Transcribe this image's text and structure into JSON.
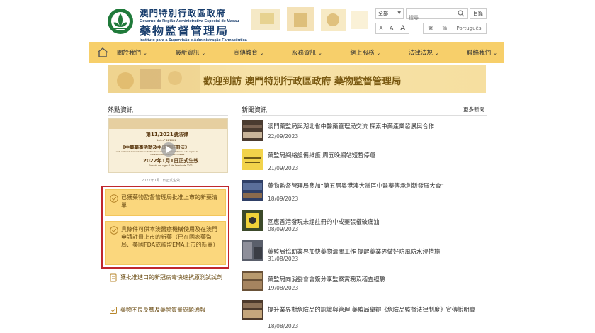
{
  "header": {
    "title_zh": "澳門特別行政區政府",
    "subtitle_pt_1": "Governo da Região Administrativa Especial de Macau",
    "title_zh_2": "藥物監督管理局",
    "subtitle_pt_2": "Instituto para a Supervisão e Administração Farmacêutica"
  },
  "search": {
    "scope_selected": "全部",
    "placeholder": "搜尋",
    "sitemap_label": "目錄"
  },
  "font_sizes": [
    "A",
    "A",
    "A"
  ],
  "languages": [
    "繁",
    "简",
    "Português"
  ],
  "nav": [
    {
      "label": "關於我們"
    },
    {
      "label": "最新資訊"
    },
    {
      "label": "宣傳教育"
    },
    {
      "label": "服務資訊"
    },
    {
      "label": "網上服務"
    },
    {
      "label": "法律法規"
    },
    {
      "label": "聯絡我們"
    }
  ],
  "welcome_text": "歡迎到訪 澳門特別行政區政府 藥物監督管理局",
  "hot": {
    "title": "熱點資訊",
    "poster": {
      "line1": "第11/2021號法律",
      "line2": "Lei n.º 11/2021",
      "line3": "《中藥藥事活動及中成藥註冊法》",
      "line4": "Lei da actividade farmacêutica no âmbito da medicina tradicional chinesa e do registo de",
      "line5": "medicamentos tradicionais chineses",
      "line6": "2022年1月1日正式生效",
      "line7": "Entrada em vigor: 1 de Janeiro de 2022",
      "caption": "2022年1月1日正式生效"
    },
    "items": [
      {
        "label": "已獲藥物監督管理局批准上市的新藥清單"
      },
      {
        "label": "具條件可供本澳醫療機構使用及在澳門申請註冊上市的新藥（已在國家藥監局、美國FDA或歐盟EMA上市的新藥）"
      },
      {
        "label": "獲批准進口的新冠病毒快速抗原測試試劑"
      },
      {
        "label": "藥物不良反應及藥物質量問題通報"
      }
    ]
  },
  "news": {
    "title": "新聞資訊",
    "more_label": "更多新聞",
    "items": [
      {
        "title": "澳門藥監局與湖北省中醫藥管理局交流 探索中藥產業發展與合作",
        "date": "22/09/2023"
      },
      {
        "title": "藥監局網絡設備維護 周五晚網站短暫停運",
        "date": "21/09/2023"
      },
      {
        "title": "藥物監督管理局參加“第五屆粵港澳大灣區中醫藥傳承創新發展大會”",
        "date": "18/09/2023"
      },
      {
        "title": "回應香港發現未經註冊的中成藥張權破痛油",
        "date": "08/09/2023"
      },
      {
        "title": "藥監局協助業界加快藥物清關工作 提醒藥業界做好防風防水浸措施",
        "date": "31/08/2023"
      },
      {
        "title": "藥監局向消委會會簽分享監察實務及稽查經驗",
        "date": "19/08/2023"
      },
      {
        "title": "提升業界對危險品的認識與管理 藥監局舉辦《危險品監督法律制度》宣傳說明會",
        "date": "18/08/2023"
      }
    ]
  },
  "colors": {
    "nav_bg": "#f7cf6a",
    "card_bg": "#fbd77d",
    "highlight_border": "#c0272d",
    "brand_blue": "#1a3f6e"
  }
}
